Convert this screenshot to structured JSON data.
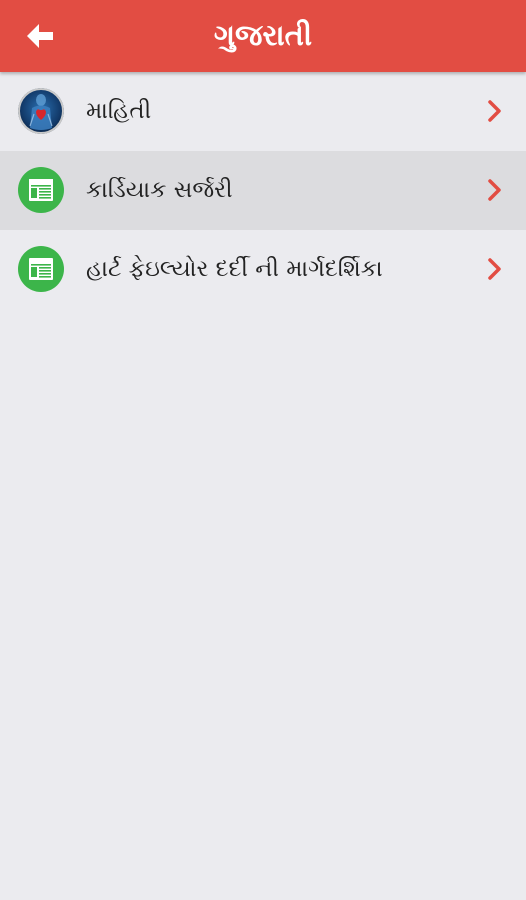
{
  "header": {
    "title": "ગુજરાતી",
    "back_icon": "arrow-left-icon",
    "background_color": "#e24d43"
  },
  "list": {
    "items": [
      {
        "label": "માહિતી",
        "icon": "heart-anatomy-icon",
        "selected": false
      },
      {
        "label": "કાર્ડિયાક સર્જરી",
        "icon": "document-icon",
        "selected": true
      },
      {
        "label": "હાર્ટ ફેઇલ્યોર દર્દી ની માર્ગદર્શિકા",
        "icon": "document-icon",
        "selected": false
      }
    ],
    "chevron_icon": "chevron-right-icon",
    "chevron_color": "#e24d43",
    "icon_color": "#3cb54a"
  }
}
